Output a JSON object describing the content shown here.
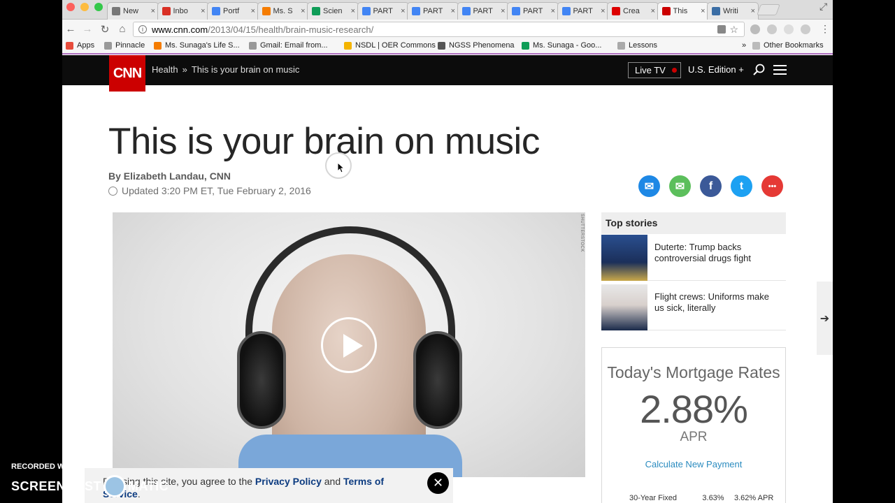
{
  "browser": {
    "tabs": [
      {
        "label": "New",
        "fav_color": "#777"
      },
      {
        "label": "Inbo",
        "fav_color": "#d93025"
      },
      {
        "label": "Portf",
        "fav_color": "#4285f4"
      },
      {
        "label": "Ms. S",
        "fav_color": "#f57c00"
      },
      {
        "label": "Scien",
        "fav_color": "#0f9d58"
      },
      {
        "label": "PART",
        "fav_color": "#4285f4"
      },
      {
        "label": "PART",
        "fav_color": "#4285f4"
      },
      {
        "label": "PART",
        "fav_color": "#4285f4"
      },
      {
        "label": "PART",
        "fav_color": "#4285f4"
      },
      {
        "label": "PART",
        "fav_color": "#4285f4"
      },
      {
        "label": "Crea",
        "fav_color": "#d00"
      },
      {
        "label": "This",
        "fav_color": "#cc0000"
      },
      {
        "label": "Writi",
        "fav_color": "#3b6ea5"
      }
    ],
    "url_host": "www.cnn.com",
    "url_path": "/2013/04/15/health/brain-music-research/",
    "bookmarks": [
      {
        "label": "Apps",
        "icon_color": "#e74c3c"
      },
      {
        "label": "Pinnacle",
        "icon_color": "#999"
      },
      {
        "label": "Ms. Sunaga's Life S...",
        "icon_color": "#f57c00"
      },
      {
        "label": "Gmail: Email from...",
        "icon_color": "#999"
      },
      {
        "label": "NSDL | OER Commons",
        "icon_color": "#f4b400"
      },
      {
        "label": "NGSS Phenomena",
        "icon_color": "#555"
      },
      {
        "label": "Ms. Sunaga - Goo...",
        "icon_color": "#0f9d58"
      },
      {
        "label": "Lessons",
        "icon_color": "#aaa"
      }
    ],
    "other_bookmarks": "Other Bookmarks",
    "overflow": "»"
  },
  "cnn": {
    "logo": "CNN",
    "crumb_section": "Health",
    "crumb_sep": "»",
    "crumb_title": "This is your brain on music",
    "live_tv": "Live TV",
    "edition": "U.S. Edition +",
    "accent": "#cc0000"
  },
  "article": {
    "headline": "This is your brain on music",
    "byline": "By Elizabeth Landau, CNN",
    "updated": "Updated 3:20 PM ET, Tue February 2, 2016",
    "share": [
      {
        "icon": "messenger-icon",
        "color": "#1e88e5"
      },
      {
        "icon": "email-icon",
        "color": "#5cbf5c"
      },
      {
        "icon": "facebook-icon",
        "color": "#3b5998"
      },
      {
        "icon": "twitter-icon",
        "color": "#1da1f2"
      },
      {
        "icon": "more-icon",
        "color": "#e53935"
      }
    ],
    "photo_credit": "SHUTTERSTOCK"
  },
  "sidebar": {
    "top_stories_label": "Top stories",
    "stories": [
      {
        "title": "Duterte: Trump backs controversial drugs fight"
      },
      {
        "title": "Flight crews: Uniforms make us sick, literally"
      }
    ]
  },
  "mortgage": {
    "title": "Today's Mortgage Rates",
    "rate": "2.88%",
    "apr_label": "APR",
    "calc_link": "Calculate New Payment",
    "row_term": "30-Year Fixed",
    "row_rate": "3.63%",
    "row_apr": "3.62% APR"
  },
  "cookie": {
    "text_prefix": "By using this site, you agree to the",
    "privacy": "Privacy Policy",
    "and": "and",
    "terms": "Terms of Service",
    "close": "✕"
  },
  "watermark": {
    "recorded": "RECORDED WITH",
    "brand_left": "SCREENCAST",
    "brand_right": "MATIC"
  }
}
